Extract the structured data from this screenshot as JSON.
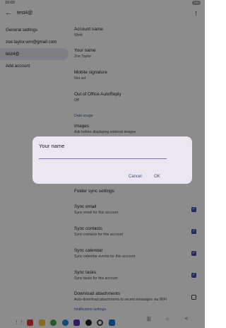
{
  "status": {
    "time": "10:00",
    "battery": "100"
  },
  "header": {
    "back_icon": "←",
    "title": "test4@",
    "menu_icon": "⋮"
  },
  "left_nav": {
    "items": [
      {
        "label": "General settings"
      },
      {
        "label": "zoe.taylor.wm@gmail.com"
      },
      {
        "label": "test4@"
      },
      {
        "label": "Add account"
      }
    ],
    "selected_index": 2
  },
  "settings": {
    "account_name": {
      "title": "Account name",
      "value": "Work"
    },
    "your_name": {
      "title": "Your name",
      "value": "Zoe Taylor"
    },
    "mobile_signature": {
      "title": "Mobile signature",
      "value": "Not set"
    },
    "ooo": {
      "title": "Out of Office AutoReply",
      "value": "Off"
    },
    "data_usage_header": "Data usage",
    "images": {
      "title": "Images",
      "value": "Ask before displaying external images"
    },
    "folder_sync": {
      "title": "Folder sync settings"
    },
    "sync_email": {
      "title": "Sync email",
      "value": "Sync email for this account",
      "checked": true
    },
    "sync_contacts": {
      "title": "Sync contacts",
      "value": "Sync contacts for this account",
      "checked": true
    },
    "sync_calendar": {
      "title": "Sync calendar",
      "value": "Sync calendar events for this account",
      "checked": true
    },
    "sync_tasks": {
      "title": "Sync tasks",
      "value": "Sync tasks for this account",
      "checked": true
    },
    "download_attachments": {
      "title": "Download attachments",
      "value": "Auto-download attachments to recent messages via WiFi",
      "checked": false
    },
    "notification_header": "Notification settings"
  },
  "dialog": {
    "title": "Your name",
    "input_value": "",
    "cancel_label": "Cancel",
    "ok_label": "OK"
  },
  "navbar": {
    "apps": [
      "apps-grid-icon",
      "red-app-icon",
      "files-icon",
      "phone-icon",
      "messages-icon",
      "chat-icon",
      "camera-icon",
      "chrome-icon",
      "drive-icon",
      "youtube-icon"
    ],
    "recents_icon": "|||",
    "home_icon": "○",
    "back_icon": "<"
  },
  "colors": {
    "accent": "#3f51b5",
    "dialog_bg": "#ece6f0",
    "selected_bg": "#e7e3f0",
    "scrim": "rgba(0,0,0,0.45)"
  }
}
